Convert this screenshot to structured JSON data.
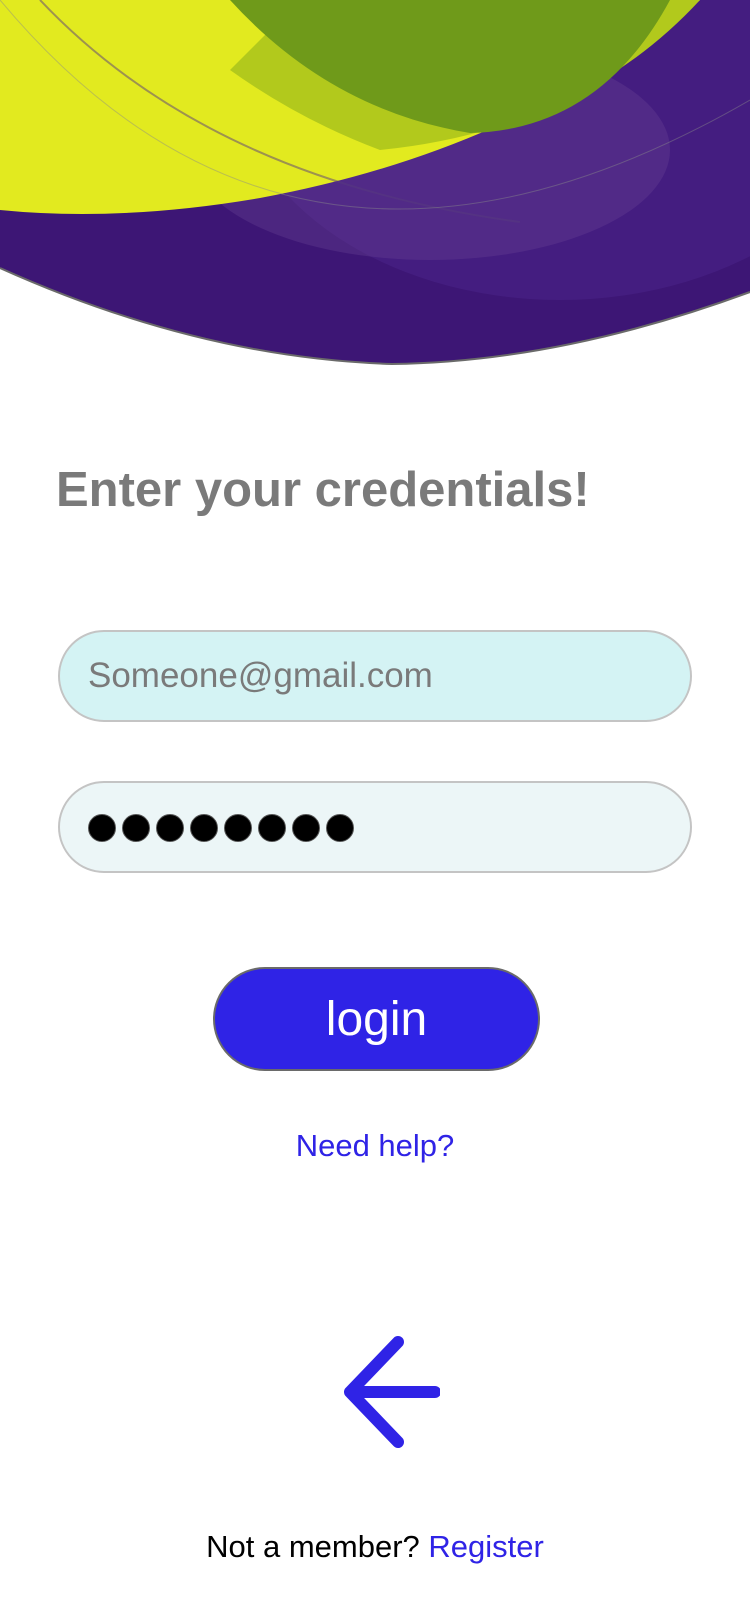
{
  "colors": {
    "accent": "#2f23e6",
    "title_text": "#7a7a7a",
    "email_field_bg": "#d4f3f4",
    "password_field_bg": "#ecf6f7",
    "hero_lime": "#e2ea1f",
    "hero_green": "#6f9a1a",
    "hero_purple": "#3d1675"
  },
  "header": {
    "title": "Enter your credentials!"
  },
  "form": {
    "email": {
      "placeholder": "Someone@gmail.com",
      "value": ""
    },
    "password": {
      "masked_length": 8
    },
    "login_label": "login"
  },
  "links": {
    "help": "Need help?"
  },
  "navigation": {
    "back_icon": "arrow-left-icon"
  },
  "footer": {
    "prompt": "Not a member?",
    "register_label": "Register"
  }
}
